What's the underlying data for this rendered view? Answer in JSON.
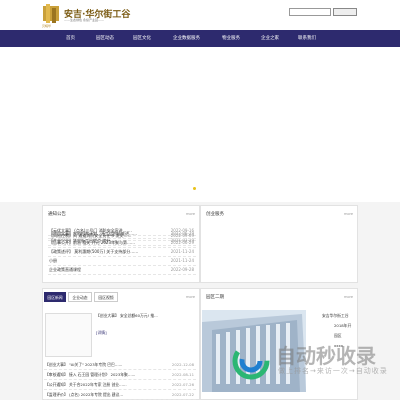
{
  "header": {
    "logo_caption": "贝皖华",
    "site_title": "安吉·华尔街工谷",
    "site_subtitle": "——生态绿色 永续产业园——",
    "search_placeholder": "",
    "search_button": ""
  },
  "nav": {
    "items": [
      "首页",
      "园区动态",
      "园区文化",
      "企业数据服务",
      "物业服务",
      "企业之家",
      "联系我们"
    ]
  },
  "notice": {
    "title": "通知公告",
    "more": "more",
    "items": [
      {
        "title": "【云优大事】 (点名)三号门 消防安全宣讲 ……",
        "date": "2022-09-16"
      },
      {
        "title": "【风险控制】风 通道消防安全责任书 发文……",
        "date": "2022-09-09"
      },
      {
        "title": "【产业兴业】华尔街工谷提点 提升 …",
        "date": "2021-03-29"
      },
      {
        "title": "【项目大事】农的回家计划、开工后积极推进……",
        "date": "2022-06-29"
      },
      {
        "title": "【告事公开】前浙 相关 开元 2023年聚与第……",
        "date": "2022-06-29"
      },
      {
        "title": "【政策述评】 莫利惠期(500万) 关于支持部分……",
        "date": "2021-11-24"
      },
      {
        "title": "小册",
        "date": "2021-11-24"
      },
      {
        "title": "企业政策直通课程",
        "date": "2022-09-28"
      }
    ]
  },
  "service": {
    "title": "创业服务",
    "more": "more"
  },
  "tabs": {
    "items": [
      "园区新闻",
      "企业动态",
      "园区视频"
    ],
    "active": 0
  },
  "news": {
    "more": "more",
    "headline": "【创业大事】 安全总额60万元! 推...",
    "headline_tag": "[详情]",
    "items": [
      {
        "title": "【创业大事】 \"AI关了\" 2023年专院 巴巴……",
        "date": "2022-12-08"
      },
      {
        "title": "【审核通知】 接入 石王园 管理计划》 2023年聚……",
        "date": "2022-08-11"
      },
      {
        "title": "【公开通知】 关于合2022年专家 注册 创业……",
        "date": "2022-07-26"
      },
      {
        "title": "【监理评价】 (点名) 2022年专院 提出 建议…",
        "date": "2022-07-22"
      }
    ]
  },
  "park": {
    "title": "园区二期",
    "more": "more",
    "name": "安吉华尔街工谷",
    "line1": "2018年开",
    "line2": "园区",
    "line3": "xxxx"
  },
  "watermark": {
    "text": "自动秒收录",
    "sub": "做上排名→来访一次→自动收录"
  },
  "colors": {
    "nav_bg": "#2d2a6e",
    "gold": "#b58a2a",
    "watermark_green": "#2bb673",
    "watermark_blue": "#1f7fd0"
  }
}
